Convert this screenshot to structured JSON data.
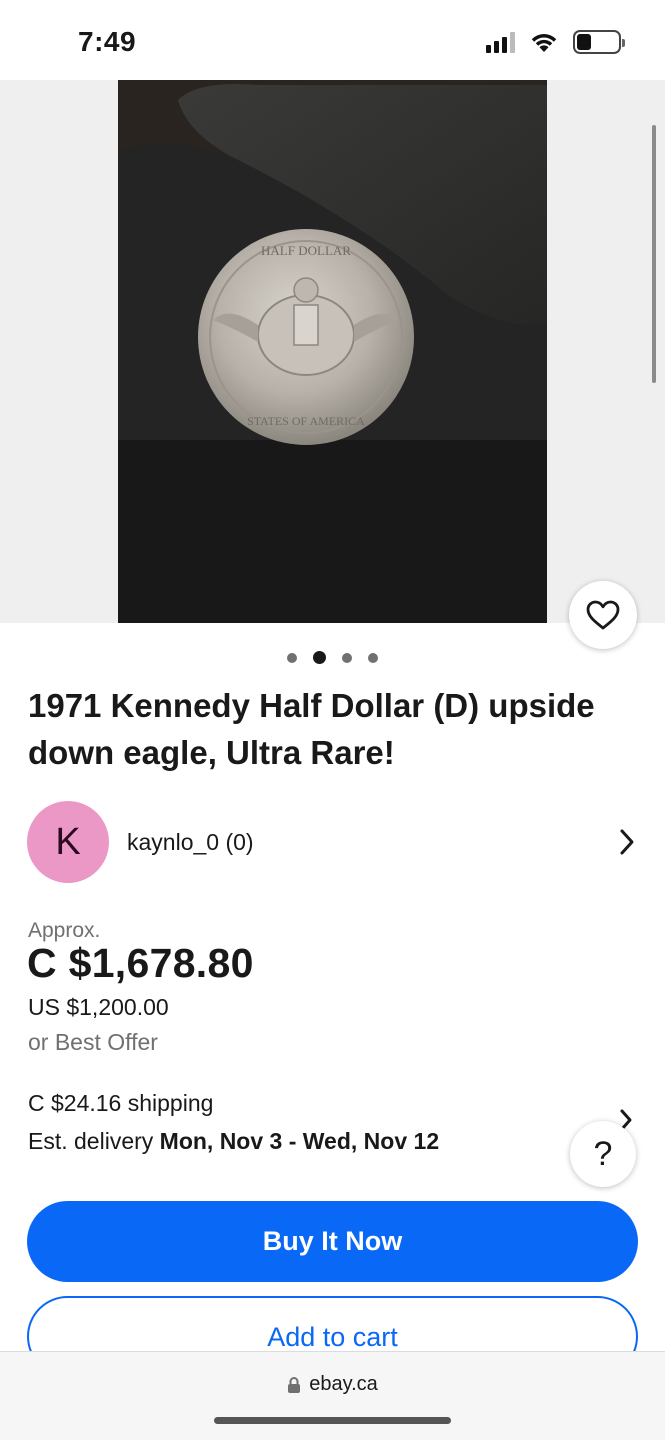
{
  "status_bar": {
    "time": "7:49",
    "icons": [
      "cellular-signal-icon",
      "wifi-icon",
      "battery-icon"
    ]
  },
  "gallery": {
    "image_count": 4,
    "active_index": 1,
    "photo_subject": "coin-photo",
    "coin_legend": [
      "UNITED STATES OF AMERICA",
      "HALF DOLLAR"
    ]
  },
  "listing": {
    "title": "1971 Kennedy Half Dollar (D) upside down eagle, Ultra Rare!",
    "seller": {
      "initial": "K",
      "name": "kaynlo_0 (0)"
    },
    "price": {
      "approx_label": "Approx.",
      "local_price": "C $1,678.80",
      "original_price": "US $1,200.00",
      "offer_text": "or Best Offer"
    },
    "shipping": {
      "cost_text": "C $24.16 shipping",
      "delivery_prefix": "Est. delivery ",
      "delivery_dates": "Mon, Nov 3 - Wed, Nov 12"
    }
  },
  "actions": {
    "buy_label": "Buy It Now",
    "cart_label": "Add to cart",
    "help_label": "?"
  },
  "browser": {
    "url": "ebay.ca"
  },
  "colors": {
    "primary": "#0968f6",
    "avatar_bg": "#ec98c7",
    "secondary_text": "#707070"
  }
}
